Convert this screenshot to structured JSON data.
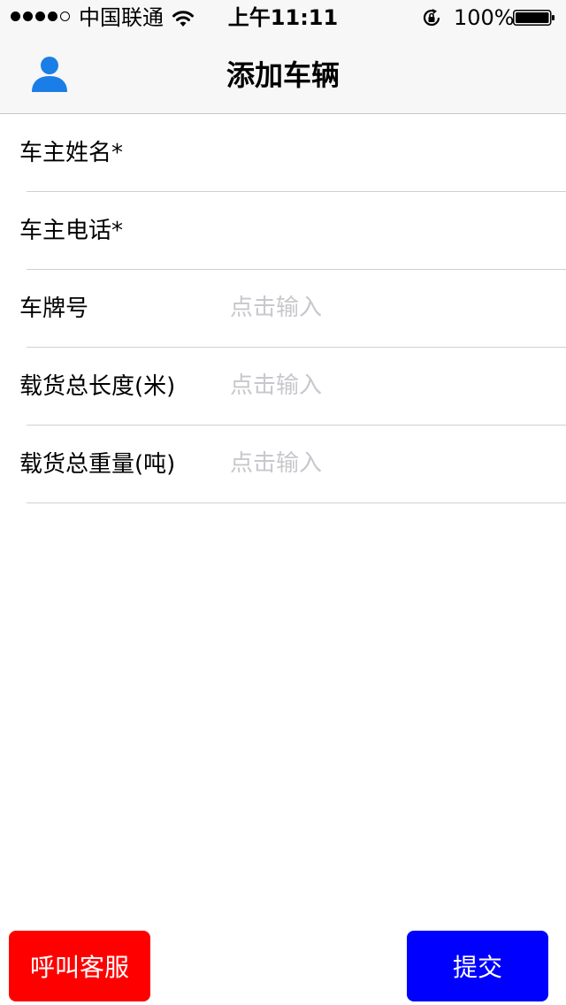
{
  "status_bar": {
    "carrier": "中国联通",
    "time": "上午11:11",
    "battery_percent": "100%",
    "signal_bars": 4,
    "signal_total": 5,
    "icons": [
      "wifi-icon",
      "rotation-lock-icon",
      "battery-icon"
    ]
  },
  "nav": {
    "title": "添加车辆",
    "left_icon": "user-icon"
  },
  "form": {
    "fields": [
      {
        "label": "车主姓名*",
        "placeholder": "",
        "value": ""
      },
      {
        "label": "车主电话*",
        "placeholder": "",
        "value": ""
      },
      {
        "label": "车牌号",
        "placeholder": "点击输入",
        "value": ""
      },
      {
        "label": "载货总长度(米)",
        "placeholder": "点击输入",
        "value": ""
      },
      {
        "label": "载货总重量(吨)",
        "placeholder": "点击输入",
        "value": ""
      }
    ]
  },
  "actions": {
    "service_label": "呼叫客服",
    "submit_label": "提交"
  },
  "colors": {
    "service_button": "#ff0000",
    "submit_button": "#0000ff",
    "user_icon": "#1a7ee6",
    "placeholder": "#c7c7cd",
    "divider": "#d0d0d0",
    "nav_background": "#f7f7f7"
  }
}
